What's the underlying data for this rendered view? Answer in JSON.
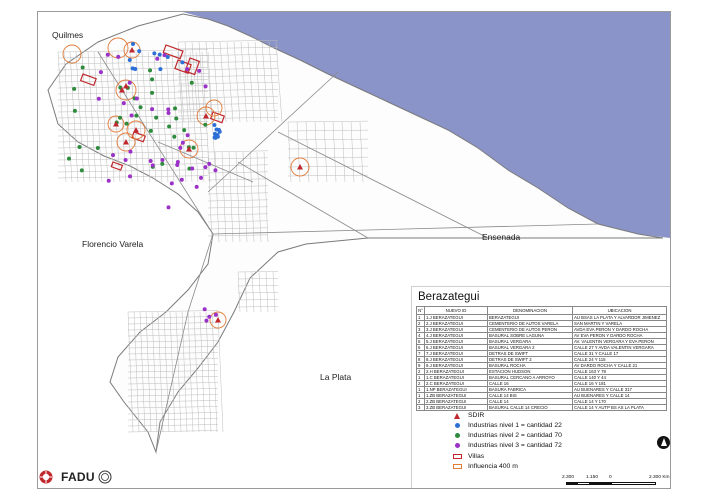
{
  "map": {
    "places": {
      "quilmes": "Quilmes",
      "florencio_varela": "Florencio Varela",
      "ensenada": "Ensenada",
      "la_plata": "La Plata"
    },
    "colors": {
      "water": "#8b94c9",
      "street": "#bdbdbd",
      "boundary": "#7a7a7a",
      "sdir": "#c0282d",
      "influence": "#e07b39",
      "industry_1": "#2d6fd6",
      "industry_2": "#2e8b3d",
      "industry_3": "#9b32c8"
    }
  },
  "legend": {
    "title": "Berazategui",
    "table": {
      "headers": [
        "N°",
        "NUEVO ID",
        "DENOMINACION",
        "UBICACION"
      ],
      "rows": [
        [
          "1",
          "1.J BERAZATEGUI",
          "BERAZATEGUI",
          "AU BSAS LA PLATA Y ALVARDOR JIMENEZ"
        ],
        [
          "2",
          "2.J BERAZATEGUI",
          "CEMENTERIO DE AUTOS VARELA",
          "SAN MARTIN Y VARELA"
        ],
        [
          "3",
          "3.J BERAZATEGUI",
          "CEMENTERIO DE AUTOS PERON",
          "AVDA EVA PERON Y DARDO ROCHA"
        ],
        [
          "4",
          "4.J BERAZATEGUI",
          "BASURAL SOBRE LAGUNA",
          "AV EVA PERON Y DARDO ROCHA"
        ],
        [
          "5",
          "5.J BERAZATEGUI",
          "BASURAL VERGARA",
          "AV. VALENTIN VERGARA Y EVA PERON"
        ],
        [
          "6",
          "6.J BERAZATEGUI",
          "BASURAL VERGARA 2",
          "CALLE 27 Y AVDA VALENTIN VERGARA"
        ],
        [
          "7",
          "7.J BERAZATEGUI",
          "DETRAS DE SWIFT",
          "CALLE 31 Y CALLE 17"
        ],
        [
          "8",
          "8.J BERAZATEGUI",
          "DETRAS DE SWIFT 2",
          "CALLE 24 Y 115"
        ],
        [
          "9",
          "9.J BERAZATEGUI",
          "BASURAL ROCHA",
          "AV DARDO ROCHA Y CALLE 21"
        ],
        [
          "2",
          "2.H BERAZATEGUI",
          "ESTACION HUDSON",
          "CALLE 163 Y 78"
        ],
        [
          "1",
          "1.C BERAZATEGUI",
          "BASURAL CERCANO A ARROYO",
          "CALLE 140 Y 44"
        ],
        [
          "2",
          "2.C BERAZATEGUI",
          "CALLE 16",
          "CALLE 16 Y 181"
        ],
        [
          "1",
          "1.NP BERAZATEGUI",
          "BASURA FABRICA",
          "AU BUENARES Y CALLE 317"
        ],
        [
          "1",
          "1.ZB BERAZATEGUI",
          "CALLE 14 BIS",
          "AU BUENARES Y CALLE 14"
        ],
        [
          "2",
          "2.ZB BERAZATEGUI",
          "CALLE 14",
          "CALLE 14 Y 170"
        ],
        [
          "3",
          "3.ZB BERAZATEGUI",
          "BASURAL CALLE 14 CRECIO",
          "CALLE 14 Y AUTP BS AS LA PLATA"
        ]
      ]
    },
    "items": {
      "sdir": "SDIR",
      "ind1": "Industrias  nivel 1 = cantidad 22",
      "ind2": "Industrias nivel 2 = cantidad 70",
      "ind3": "Industrias nivel 3 = cantidad 72",
      "villas": "Villas",
      "influencia": "Influencia 400 m"
    },
    "scale": {
      "labels": [
        "2.300",
        "1.150",
        "0",
        "2.300 Km"
      ]
    }
  },
  "logo": {
    "text": "FADU"
  }
}
